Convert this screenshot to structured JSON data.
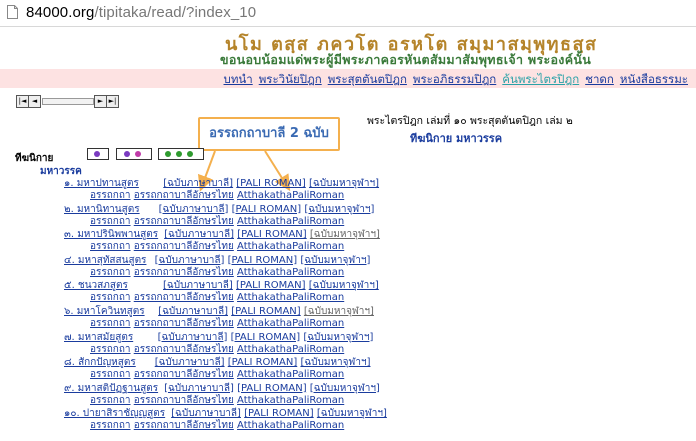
{
  "browser": {
    "url_domain": "84000.org",
    "url_path": "/tipitaka/read/?index_10"
  },
  "header": {
    "title": "นโม ตสฺส ภควโต อรหโต สมฺมาสมฺพุทฺธสฺส",
    "subtitle": "ขอนอบน้อมแด่พระผู้มีพระภาคอรหันตสัมมาสัมพุทธเจ้า พระองค์นั้น"
  },
  "nav": {
    "items": [
      "บทนำ",
      "พระวินัยปิฎก",
      "พระสุตตันตปิฎก",
      "พระอภิธรรมปิฎก",
      "ค้นพระไตรปิฎก",
      "ชาดก",
      "หนังสือธรรมะ"
    ],
    "active_index": 4
  },
  "pager": {
    "first": "◄",
    "last": "►"
  },
  "crumb": {
    "line1": "พระไตรปิฎก เล่มที่ ๑๐ พระสุตตันตปิฎก เล่ม ๒",
    "line2": "ทีฆนิกาย มหาวรรค"
  },
  "callout": {
    "text": "อรรถกถาบาลี 2 ฉบับ"
  },
  "group": {
    "label": "ทีฆนิกาย",
    "sub": "มหาวรรค"
  },
  "colors": {
    "link": "#1a3c9e",
    "title": "#b5842a",
    "subtitle": "#3a7a3a",
    "navbar": "#fde2e2",
    "callout_border": "#f4b04e"
  },
  "suttas": [
    {
      "title": "๑. มหาปทานสูตร",
      "pali": "[ฉบับภาษาบาลี]",
      "roman": "[PALI ROMAN]",
      "mcu": "[ฉบับมหาจุฬาฯ]",
      "attha": "อรรถกถา",
      "attha_lex": "อรรถกถาบาลีอักษรไทย",
      "attha_roman": "AtthakathaPaliRoman"
    },
    {
      "title": "๒. มหานิทานสูตร",
      "pali": "[ฉบับภาษาบาลี]",
      "roman": "[PALI ROMAN]",
      "mcu": "[ฉบับมหาจุฬาฯ]",
      "attha": "อรรถกถา",
      "attha_lex": "อรรถกถาบาลีอักษรไทย",
      "attha_roman": "AtthakathaPaliRoman"
    },
    {
      "title": "๓. มหาปรินิพพานสูตร",
      "pali": "[ฉบับภาษาบาลี]",
      "roman": "[PALI ROMAN]",
      "mcu": "[ฉบับมหาจุฬาฯ]",
      "attha": "อรรถกถา",
      "attha_lex": "อรรถกถาบาลีอักษรไทย",
      "attha_roman": "AtthakathaPaliRoman"
    },
    {
      "title": "๔. มหาสุทัสสนสูตร",
      "pali": "[ฉบับภาษาบาลี]",
      "roman": "[PALI ROMAN]",
      "mcu": "[ฉบับมหาจุฬาฯ]",
      "attha": "อรรถกถา",
      "attha_lex": "อรรถกถาบาลีอักษรไทย",
      "attha_roman": "AtthakathaPaliRoman"
    },
    {
      "title": "๕. ชนวสภสูตร",
      "pali": "[ฉบับภาษาบาลี]",
      "roman": "[PALI ROMAN]",
      "mcu": "[ฉบับมหาจุฬาฯ]",
      "attha": "อรรถกถา",
      "attha_lex": "อรรถกถาบาลีอักษรไทย",
      "attha_roman": "AtthakathaPaliRoman"
    },
    {
      "title": "๖. มหาโควินทสูตร",
      "pali": "[ฉบับภาษาบาลี]",
      "roman": "[PALI ROMAN]",
      "mcu": "[ฉบับมหาจุฬาฯ]",
      "attha": "อรรถกถา",
      "attha_lex": "อรรถกถาบาลีอักษรไทย",
      "attha_roman": "AtthakathaPaliRoman"
    },
    {
      "title": "๗. มหาสมัยสูตร",
      "pali": "[ฉบับภาษาบาลี]",
      "roman": "[PALI ROMAN]",
      "mcu": "[ฉบับมหาจุฬาฯ]",
      "attha": "อรรถกถา",
      "attha_lex": "อรรถกถาบาลีอักษรไทย",
      "attha_roman": "AtthakathaPaliRoman"
    },
    {
      "title": "๘. สักกปัญหสูตร",
      "pali": "[ฉบับภาษาบาลี]",
      "roman": "[PALI ROMAN]",
      "mcu": "[ฉบับมหาจุฬาฯ]",
      "attha": "อรรถกถา",
      "attha_lex": "อรรถกถาบาลีอักษรไทย",
      "attha_roman": "AtthakathaPaliRoman"
    },
    {
      "title": "๙. มหาสติปัฏฐานสูตร",
      "pali": "[ฉบับภาษาบาลี]",
      "roman": "[PALI ROMAN]",
      "mcu": "[ฉบับมหาจุฬาฯ]",
      "attha": "อรรถกถา",
      "attha_lex": "อรรถกถาบาลีอักษรไทย",
      "attha_roman": "AtthakathaPaliRoman"
    },
    {
      "title": "๑๐. ปายาสิราชัญญสูตร",
      "pali": "[ฉบับภาษาบาลี]",
      "roman": "[PALI ROMAN]",
      "mcu": "[ฉบับมหาจุฬาฯ]",
      "attha": "อรรถกถา",
      "attha_lex": "อรรถกถาบาลีอักษรไทย",
      "attha_roman": "AtthakathaPaliRoman"
    }
  ]
}
